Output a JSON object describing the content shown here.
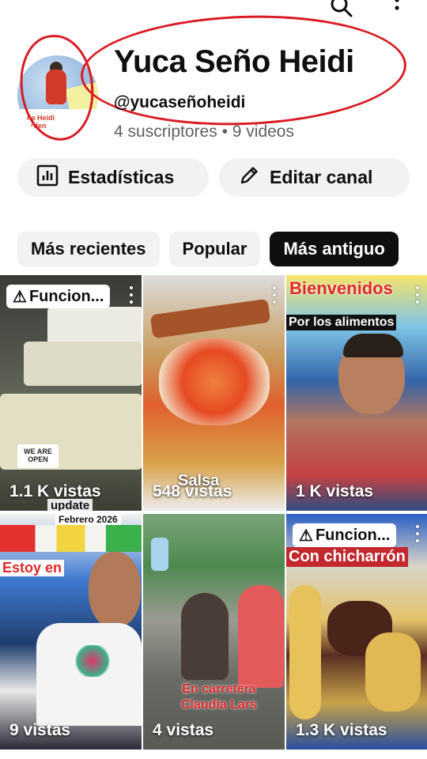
{
  "header": {
    "icons": [
      "search-icon",
      "more-vert-icon"
    ]
  },
  "channel": {
    "name": "Yuca Seño Heidi",
    "handle": "@yucaseñoheidi",
    "subscribers": "4 suscriptores",
    "separator": "•",
    "videos": "9 videos",
    "avatar_text": "ña Heidi\narden"
  },
  "buttons": {
    "stats_label": "Estadísticas",
    "edit_label": "Editar canal"
  },
  "filters": {
    "chips": [
      "Más recientes",
      "Popular",
      "Más antiguo"
    ],
    "selected": "Más antiguo"
  },
  "annotations": {
    "color": "#d81b24"
  },
  "videos": [
    {
      "views": "1.1 K vistas",
      "badge": "Funcion...",
      "sign": "WE ARE OPEN",
      "bottom_caption": "update"
    },
    {
      "views": "548 vistas",
      "caption": "Salsa"
    },
    {
      "views": "1 K vistas",
      "caption_top": "Bienvenidos",
      "caption": "Por los alimentos"
    },
    {
      "views": "9 vistas",
      "caption_top": "Febrero 2026",
      "caption": "Estoy en"
    },
    {
      "views": "4 vistas",
      "caption": "En carretera Claudia Lars"
    },
    {
      "views": "1.3 K vistas",
      "badge": "Funcion...",
      "caption": "Con chicharrón"
    }
  ]
}
